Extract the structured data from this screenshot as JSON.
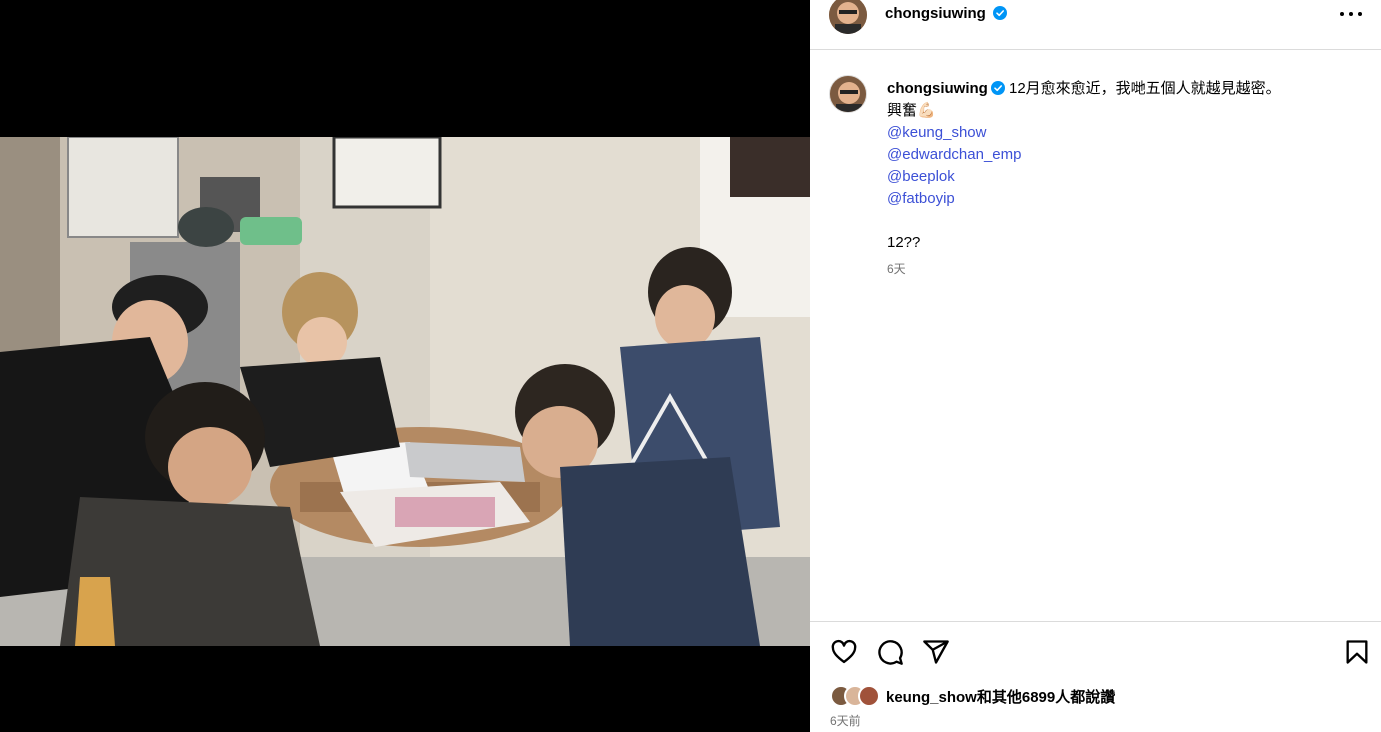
{
  "post": {
    "username": "chongsiuwing",
    "more_icon": "more-horizontal-icon"
  },
  "caption": {
    "username": "chongsiuwing",
    "text_line1": "12月愈來愈近，我哋五個人就越見越密。",
    "text_line2": "興奮💪🏻",
    "mentions": [
      "@keung_show",
      "@edwardchan_emp",
      "@beeplok",
      "@fatboyip"
    ],
    "text_end": "12??",
    "time": "6天"
  },
  "likes": {
    "user": "keung_show",
    "text": "和其他6899人都說讚"
  },
  "post_time": "6天前",
  "icons": {
    "like": "heart-icon",
    "comment": "comment-icon",
    "share": "send-icon",
    "save": "bookmark-icon",
    "verified": "verified-badge-icon"
  },
  "colors": {
    "link": "#3c50d6",
    "verified": "#0095f6",
    "muted": "#737373",
    "divider": "#dbdbdb"
  }
}
